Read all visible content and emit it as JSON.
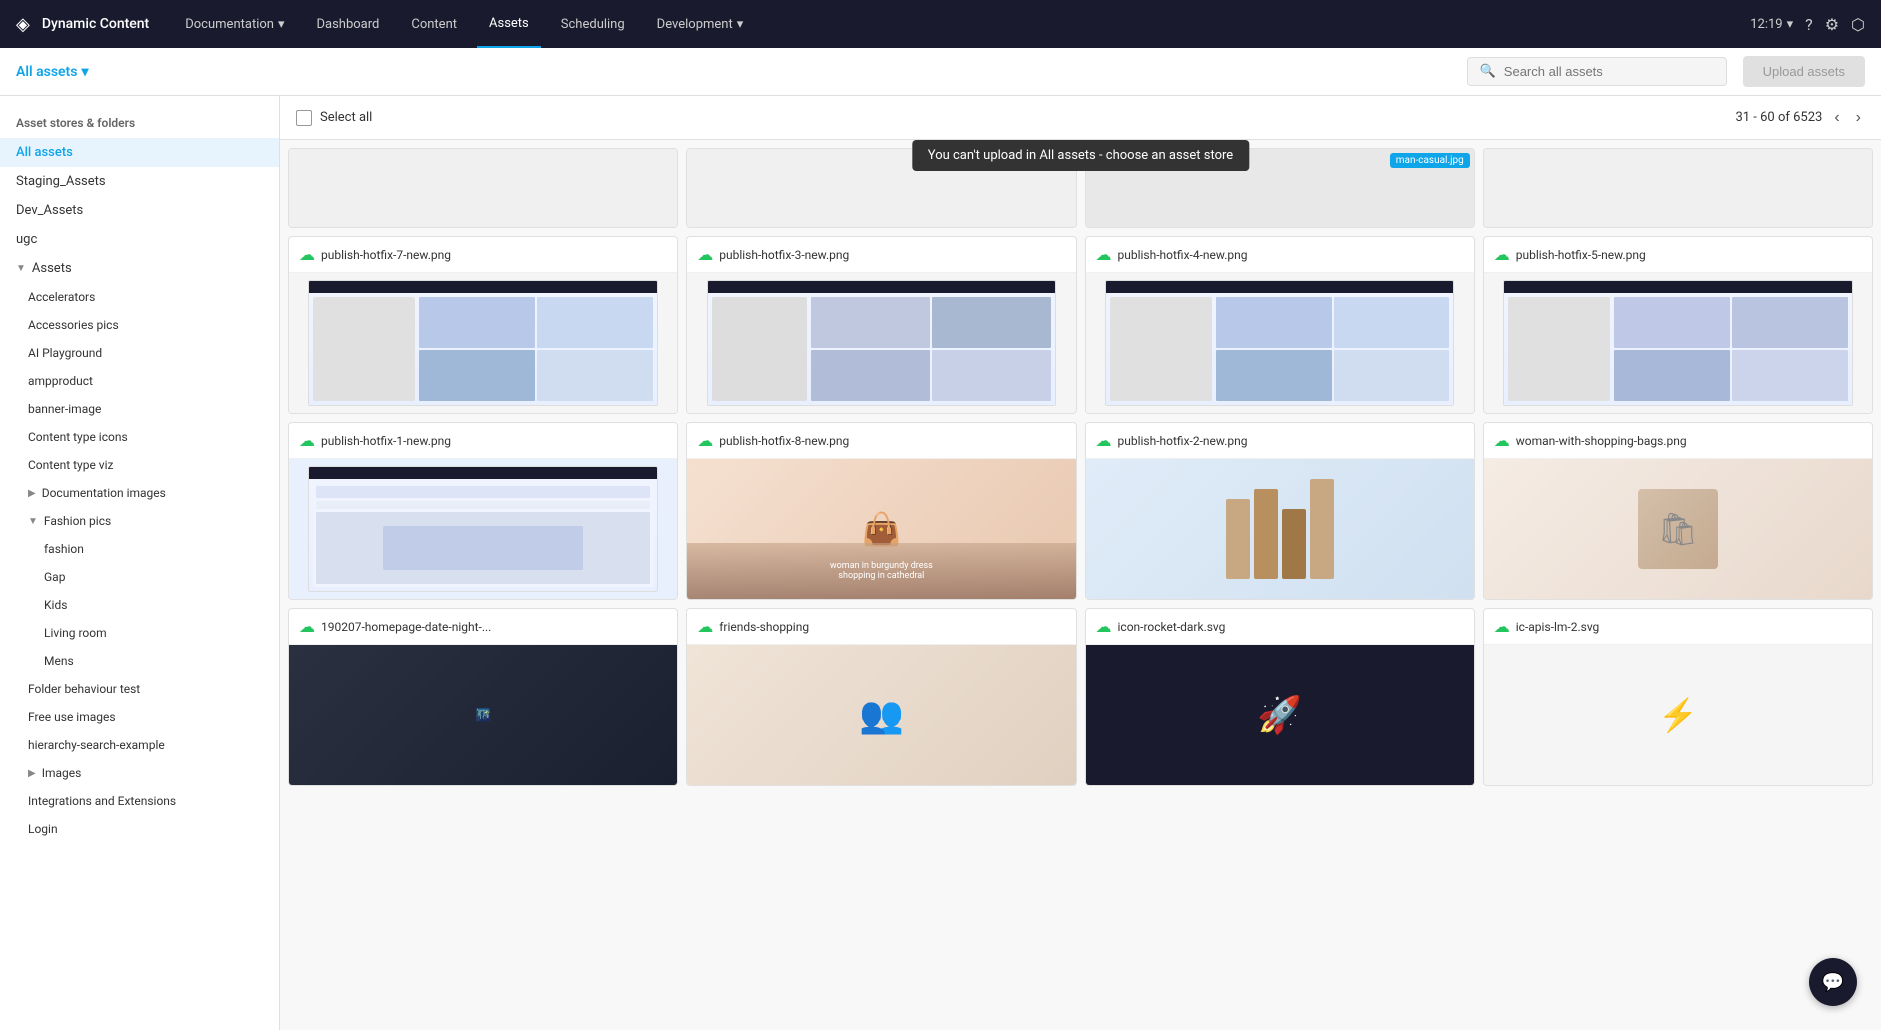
{
  "app": {
    "logo": "◈",
    "brand": "Dynamic Content",
    "nav_items": [
      {
        "label": "Documentation",
        "has_arrow": true,
        "active": false
      },
      {
        "label": "Dashboard",
        "has_arrow": false,
        "active": false
      },
      {
        "label": "Content",
        "has_arrow": false,
        "active": false
      },
      {
        "label": "Assets",
        "has_arrow": false,
        "active": true
      },
      {
        "label": "Scheduling",
        "has_arrow": false,
        "active": false
      },
      {
        "label": "Development",
        "has_arrow": true,
        "active": false
      }
    ],
    "time": "12:19",
    "search_placeholder": "Search all assets",
    "upload_label": "Upload assets",
    "all_assets_label": "All assets"
  },
  "toolbar": {
    "select_all": "Select all",
    "pagination": "31 - 60 of 6523",
    "tooltip": "You can't upload in All assets - choose an asset store"
  },
  "sidebar": {
    "title": "Asset stores & folders",
    "items": [
      {
        "label": "All assets",
        "active": true,
        "indent": 0
      },
      {
        "label": "Staging_Assets",
        "active": false,
        "indent": 0
      },
      {
        "label": "Dev_Assets",
        "active": false,
        "indent": 0
      },
      {
        "label": "ugc",
        "active": false,
        "indent": 0
      },
      {
        "label": "Assets",
        "active": false,
        "indent": 0,
        "expanded": true
      },
      {
        "label": "Accelerators",
        "active": false,
        "indent": 1
      },
      {
        "label": "Accessories pics",
        "active": false,
        "indent": 1
      },
      {
        "label": "AI Playground",
        "active": false,
        "indent": 1
      },
      {
        "label": "ampproduct",
        "active": false,
        "indent": 1
      },
      {
        "label": "banner-image",
        "active": false,
        "indent": 1
      },
      {
        "label": "Content type icons",
        "active": false,
        "indent": 1
      },
      {
        "label": "Content type viz",
        "active": false,
        "indent": 1
      },
      {
        "label": "Documentation images",
        "active": false,
        "indent": 1,
        "has_expand": true
      },
      {
        "label": "Fashion pics",
        "active": false,
        "indent": 1,
        "expanded": true
      },
      {
        "label": "fashion",
        "active": false,
        "indent": 2
      },
      {
        "label": "Gap",
        "active": false,
        "indent": 2
      },
      {
        "label": "Kids",
        "active": false,
        "indent": 2
      },
      {
        "label": "Living room",
        "active": false,
        "indent": 2
      },
      {
        "label": "Mens",
        "active": false,
        "indent": 2
      },
      {
        "label": "Folder behaviour test",
        "active": false,
        "indent": 1
      },
      {
        "label": "Free use images",
        "active": false,
        "indent": 1
      },
      {
        "label": "hierarchy-search-example",
        "active": false,
        "indent": 1
      },
      {
        "label": "Images",
        "active": false,
        "indent": 1,
        "has_expand": true
      },
      {
        "label": "Integrations and Extensions",
        "active": false,
        "indent": 1
      },
      {
        "label": "Login",
        "active": false,
        "indent": 1
      }
    ]
  },
  "assets": {
    "rows": [
      [
        {
          "name": "publish-hotfix-7-new.png",
          "type": "screenshot",
          "tag": null
        },
        {
          "name": "publish-hotfix-3-new.png",
          "type": "screenshot",
          "tag": null
        },
        {
          "name": "publish-hotfix-4-new.png",
          "type": "screenshot",
          "tag": "man-casual.jpg"
        },
        {
          "name": "publish-hotfix-5-new.png",
          "type": "screenshot",
          "tag": null
        }
      ],
      [
        {
          "name": "publish-hotfix-1-new.png",
          "type": "screenshot2",
          "tag": null
        },
        {
          "name": "publish-hotfix-8-new.png",
          "type": "shopping",
          "tag": null
        },
        {
          "name": "publish-hotfix-2-new.png",
          "type": "shopping2",
          "tag": null
        },
        {
          "name": "woman-with-shopping-bags.png",
          "type": "shopping3",
          "tag": null
        }
      ],
      [
        {
          "name": "190207-homepage-date-night-...",
          "type": "dark",
          "tag": null
        },
        {
          "name": "friends-shopping",
          "type": "dark2",
          "tag": null
        },
        {
          "name": "icon-rocket-dark.svg",
          "type": "icon",
          "tag": null
        },
        {
          "name": "ic-apis-lm-2.svg",
          "type": "icon2",
          "tag": null
        }
      ]
    ]
  }
}
